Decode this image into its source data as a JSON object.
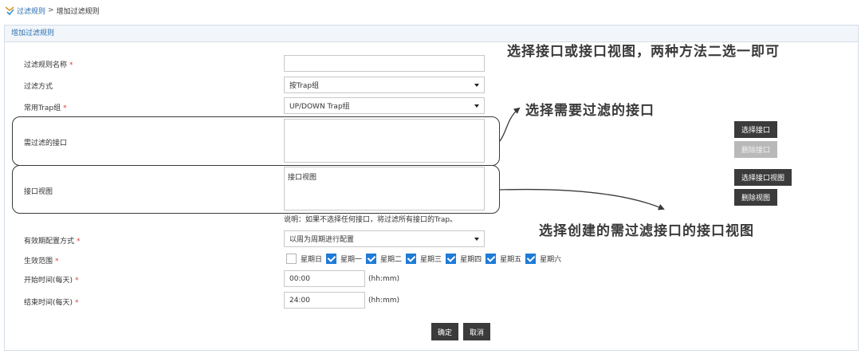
{
  "breadcrumb": {
    "parent": "过滤规则",
    "separator": ">",
    "current": "增加过滤规则"
  },
  "panel": {
    "title": "增加过滤规则"
  },
  "form": {
    "rule_name": {
      "label": "过滤规则名称",
      "required": "*",
      "value": ""
    },
    "filter_method": {
      "label": "过滤方式",
      "value": "按Trap组"
    },
    "trap_group": {
      "label": "常用Trap组",
      "required": "*",
      "value": "UP/DOWN Trap组"
    },
    "interfaces": {
      "label": "需过滤的接口",
      "value": ""
    },
    "interface_view": {
      "label": "接口视图",
      "value": "接口视图"
    },
    "note": "说明：如果不选择任何接口，将过滤所有接口的Trap。",
    "validity_mode": {
      "label": "有效期配置方式",
      "required": "*",
      "value": "以周为周期进行配置"
    },
    "effective_range": {
      "label": "生效范围",
      "required": "*",
      "days": [
        {
          "label": "星期日",
          "checked": false
        },
        {
          "label": "星期一",
          "checked": true
        },
        {
          "label": "星期二",
          "checked": true
        },
        {
          "label": "星期三",
          "checked": true
        },
        {
          "label": "星期四",
          "checked": true
        },
        {
          "label": "星期五",
          "checked": true
        },
        {
          "label": "星期六",
          "checked": true
        }
      ]
    },
    "start_time": {
      "label": "开始时间(每天)",
      "required": "*",
      "value": "00:00",
      "unit": "(hh:mm)"
    },
    "end_time": {
      "label": "结束时间(每天)",
      "required": "*",
      "value": "24:00",
      "unit": "(hh:mm)"
    }
  },
  "buttons": {
    "select_interface": "选择接口",
    "delete_interface": "删除接口",
    "select_view": "选择接口视图",
    "delete_view": "删除视图",
    "confirm": "确定",
    "cancel": "取消"
  },
  "annotations": {
    "top": "选择接口或接口视图，两种方法二选一即可",
    "interface": "选择需要过滤的接口",
    "view": "选择创建的需过滤接口的接口视图"
  },
  "colors": {
    "link": "#2a6eb0",
    "required": "#e03c3c",
    "button": "#3b3b3b",
    "checkbox": "#1e7bd6"
  }
}
